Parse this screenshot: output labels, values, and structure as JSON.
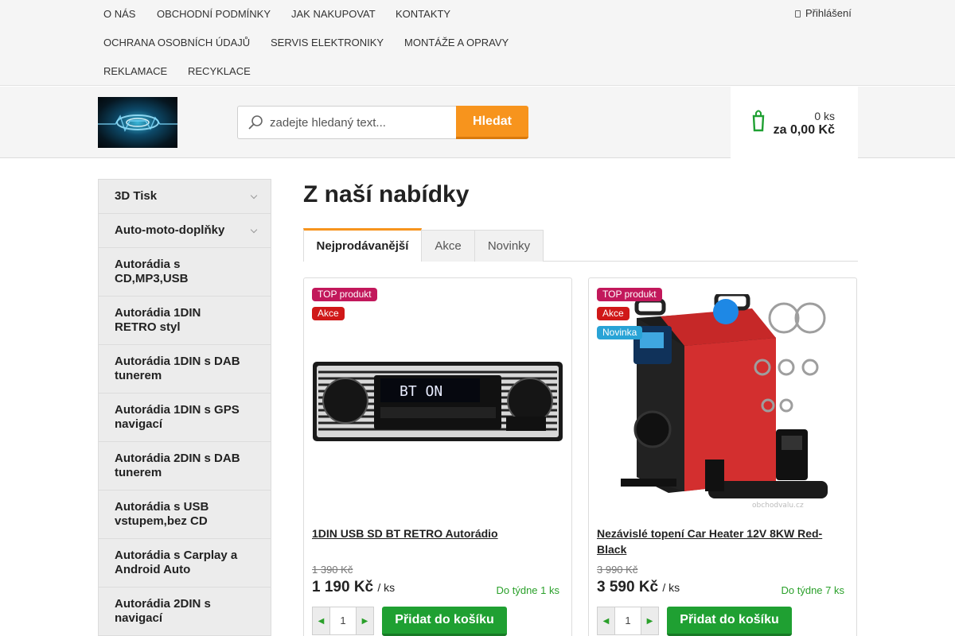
{
  "topnav": {
    "links": [
      "O NÁS",
      "OBCHODNÍ PODMÍNKY",
      "JAK NAKUPOVAT",
      "KONTAKTY",
      "OCHRANA OSOBNÍCH ÚDAJŮ",
      "SERVIS ELEKTRONIKY",
      "MONTÁŽE A OPRAVY",
      "REKLAMACE",
      "RECYKLACE"
    ],
    "login_label": "Přihlášení",
    "login_icon": "lock-icon"
  },
  "header": {
    "search_placeholder": "zadejte hledaný text...",
    "search_button": "Hledat",
    "cart_count": "0 ks",
    "cart_total": "za 0,00 Kč",
    "cart_icon": "cart-icon",
    "accent_color": "#f7941d"
  },
  "sidebar": {
    "categories": [
      {
        "label": "3D Tisk",
        "has_submenu": true
      },
      {
        "label": "Auto-moto-doplňky",
        "has_submenu": true
      },
      {
        "label": "Autorádia s CD,MP3,USB",
        "has_submenu": false
      },
      {
        "label": "Autorádia 1DIN RETRO styl",
        "has_submenu": false
      },
      {
        "label": "Autorádia 1DIN s DAB tunerem",
        "has_submenu": false
      },
      {
        "label": "Autorádia 1DIN s GPS navigací",
        "has_submenu": false
      },
      {
        "label": "Autorádia 2DIN s DAB tunerem",
        "has_submenu": false
      },
      {
        "label": "Autorádia s USB vstupem,bez CD",
        "has_submenu": false
      },
      {
        "label": "Autorádia s Carplay a Android Auto",
        "has_submenu": false
      },
      {
        "label": "Autorádia 2DIN s navigací",
        "has_submenu": false
      }
    ]
  },
  "main": {
    "heading": "Z naší nabídky",
    "tabs": [
      "Nejprodávanější",
      "Akce",
      "Novinky"
    ],
    "products": [
      {
        "badges": [
          "TOP produkt",
          "Akce"
        ],
        "name": "1DIN USB SD BT RETRO Autorádio",
        "old_price": "1 390 Kč",
        "price": "1 190 Kč",
        "unit": "/ ks",
        "stock": "Do týdne 1 ks",
        "quantity": "1",
        "add_button": "Přidat do košíku",
        "display_text": "BT ON"
      },
      {
        "badges": [
          "TOP produkt",
          "Akce",
          "Novinka"
        ],
        "name": "Nezávislé topení Car Heater 12V 8KW Red-Black",
        "old_price": "3 990 Kč",
        "price": "3 590 Kč",
        "unit": "/ ks",
        "stock": "Do týdne 7 ks",
        "quantity": "1",
        "add_button": "Přidat do košíku",
        "watermark": "obchodvalu.cz"
      }
    ]
  }
}
